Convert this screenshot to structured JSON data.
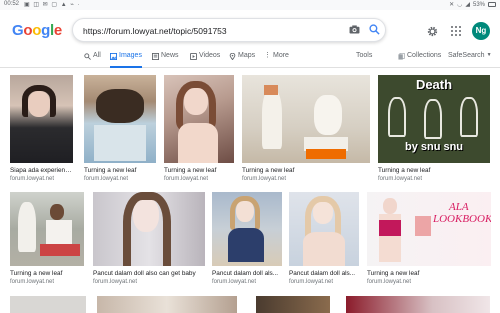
{
  "status": {
    "time": "00:52",
    "battery": "53%"
  },
  "logo_letters": [
    "G",
    "o",
    "o",
    "g",
    "l",
    "e"
  ],
  "search": {
    "query": "https://forum.lowyat.net/topic/5091753"
  },
  "user": {
    "initials": "Ng"
  },
  "tabs": {
    "all": "All",
    "images": "Images",
    "news": "News",
    "videos": "Videos",
    "maps": "Maps",
    "more": "More",
    "tools": "Tools",
    "collections": "Collections",
    "safesearch": "SafeSearch"
  },
  "colors": {
    "accent": "#1a73e8",
    "avatar": "#00897b"
  },
  "results": [
    {
      "title": "Siapa ada experienc...",
      "source": "forum.lowyat.net"
    },
    {
      "title": "Turning a new leaf",
      "source": "forum.lowyat.net"
    },
    {
      "title": "Turning a new leaf",
      "source": "forum.lowyat.net"
    },
    {
      "title": "Turning a new leaf",
      "source": "forum.lowyat.net"
    },
    {
      "title": "Turning a new leaf",
      "source": "forum.lowyat.net"
    },
    {
      "title": "Turning a new leaf",
      "source": "forum.lowyat.net"
    },
    {
      "title": "Pancut dalam doll also can get baby",
      "source": "forum.lowyat.net"
    },
    {
      "title": "Pancut dalam doll als...",
      "source": "forum.lowyat.net"
    },
    {
      "title": "Pancut dalam doll als...",
      "source": "forum.lowyat.net"
    },
    {
      "title": "Turning a new leaf",
      "source": "forum.lowyat.net"
    }
  ],
  "image_text": {
    "death_top": "Death",
    "death_bottom": "by snu snu",
    "lookbook_1": "ALA",
    "lookbook_2": "LOOKBOOK"
  }
}
